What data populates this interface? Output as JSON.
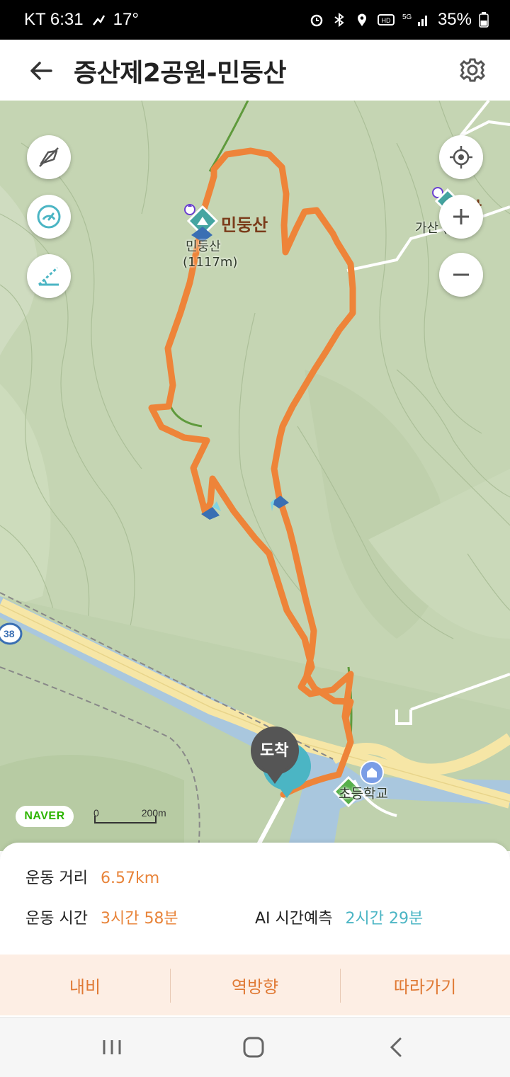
{
  "status": {
    "carrier_time": "KT 6:31",
    "temp": "17°",
    "battery": "35%"
  },
  "header": {
    "title": "증산제2공원-민둥산"
  },
  "map": {
    "peak_label": "민둥산",
    "peak_sub1": "민둥산",
    "peak_sub2": "(1117m)",
    "gasan_label": "산",
    "gasan_sub": "가산 (      m)",
    "route_badge": "38",
    "arrival_label": "도착",
    "school_label": "  초등학교",
    "naver": "NAVER",
    "scale_zero": "0",
    "scale_value": "200m",
    "route_color": "#ee8439"
  },
  "stats": {
    "distance_label": "운동 거리",
    "distance_value": "6.57km",
    "time_label": "운동 시간",
    "time_value": "3시간 58분",
    "ai_label": "AI 시간예측",
    "ai_value": "2시간 29분"
  },
  "actions": {
    "navi": "내비",
    "reverse": "역방향",
    "follow": "따라가기"
  }
}
